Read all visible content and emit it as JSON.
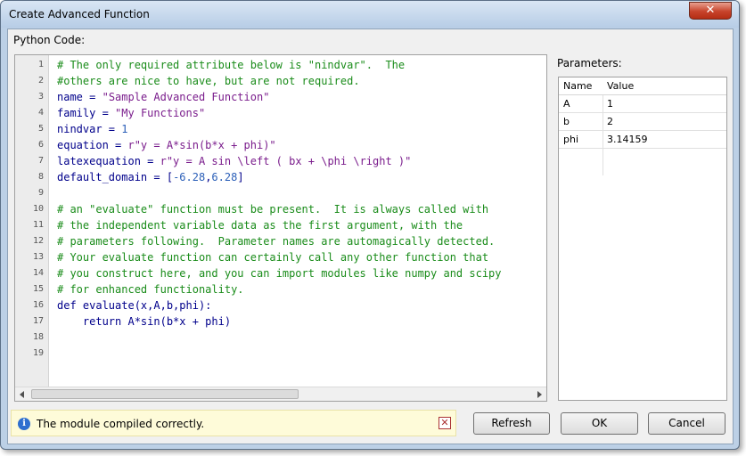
{
  "window": {
    "title": "Create Advanced Function",
    "close_glyph": "✕"
  },
  "editor": {
    "label": "Python Code:",
    "lines": [
      [
        {
          "t": "# The only required attribute below is \"nindvar\".  The",
          "c": "c"
        }
      ],
      [
        {
          "t": "#others are nice to have, but are not required.",
          "c": "c"
        }
      ],
      [
        {
          "t": "name",
          "c": "k"
        },
        {
          "t": " = ",
          "c": "k"
        },
        {
          "t": "\"Sample Advanced Function\"",
          "c": "s"
        }
      ],
      [
        {
          "t": "family",
          "c": "k"
        },
        {
          "t": " = ",
          "c": "k"
        },
        {
          "t": "\"My Functions\"",
          "c": "s"
        }
      ],
      [
        {
          "t": "nindvar",
          "c": "k"
        },
        {
          "t": " = ",
          "c": "k"
        },
        {
          "t": "1",
          "c": "n"
        }
      ],
      [
        {
          "t": "equation",
          "c": "k"
        },
        {
          "t": " = ",
          "c": "k"
        },
        {
          "t": "r\"y = A*sin(b*x + phi)\"",
          "c": "s"
        }
      ],
      [
        {
          "t": "latexequation",
          "c": "k"
        },
        {
          "t": " = ",
          "c": "k"
        },
        {
          "t": "r\"y = A sin \\left ( bx + \\phi \\right )\"",
          "c": "s"
        }
      ],
      [
        {
          "t": "default_domain",
          "c": "k"
        },
        {
          "t": " = [",
          "c": "k"
        },
        {
          "t": "-6.28",
          "c": "n"
        },
        {
          "t": ",",
          "c": "k"
        },
        {
          "t": "6.28",
          "c": "n"
        },
        {
          "t": "]",
          "c": "k"
        }
      ],
      [],
      [
        {
          "t": "# an \"evaluate\" function must be present.  It is always called with",
          "c": "c"
        }
      ],
      [
        {
          "t": "# the independent variable data as the first argument, with the",
          "c": "c"
        }
      ],
      [
        {
          "t": "# parameters following.  Parameter names are automagically detected.",
          "c": "c"
        }
      ],
      [
        {
          "t": "# Your evaluate function can certainly call any other function that",
          "c": "c"
        }
      ],
      [
        {
          "t": "# you construct here, and you can import modules like numpy and scipy",
          "c": "c"
        }
      ],
      [
        {
          "t": "# for enhanced functionality.",
          "c": "c"
        }
      ],
      [
        {
          "t": "def",
          "c": "k"
        },
        {
          "t": " evaluate(x,A,b,phi):",
          "c": "k"
        }
      ],
      [
        {
          "t": "    return",
          "c": "k"
        },
        {
          "t": " A*sin(b*x + phi)",
          "c": "k"
        }
      ],
      [],
      []
    ]
  },
  "parameters": {
    "label": "Parameters:",
    "columns": [
      "Name",
      "Value"
    ],
    "rows": [
      {
        "name": "A",
        "value": "1"
      },
      {
        "name": "b",
        "value": "2"
      },
      {
        "name": "phi",
        "value": "3.14159"
      }
    ]
  },
  "status": {
    "message": "The module compiled correctly.",
    "icon": "info-icon",
    "dismiss_glyph": "✕"
  },
  "buttons": {
    "refresh": "Refresh",
    "ok": "OK",
    "cancel": "Cancel"
  }
}
